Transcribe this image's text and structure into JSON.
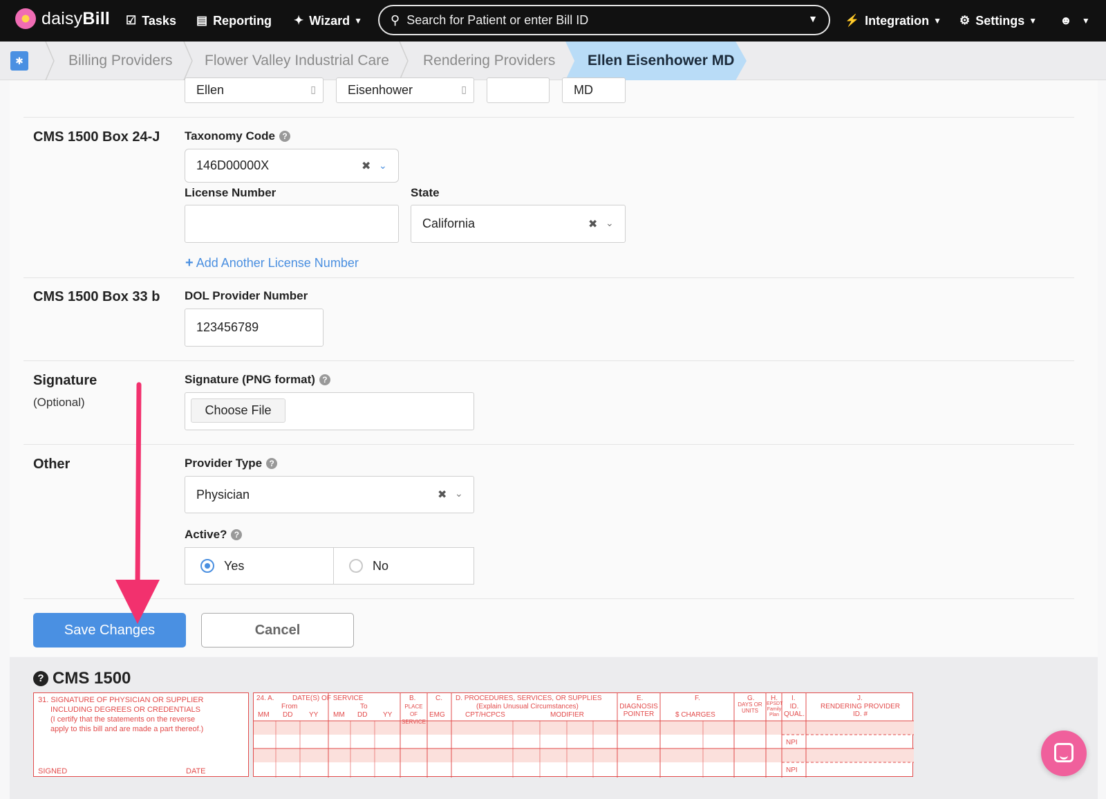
{
  "nav": {
    "logo_prefix": "daisy",
    "logo_suffix": "Bill",
    "tasks": "Tasks",
    "reporting": "Reporting",
    "wizard": "Wizard",
    "search_placeholder": "Search for Patient or enter Bill ID",
    "integration": "Integration",
    "settings": "Settings"
  },
  "breadcrumbs": [
    "Billing Providers",
    "Flower Valley Industrial Care",
    "Rendering Providers",
    "Ellen Eisenhower MD"
  ],
  "name_row": {
    "first_name": "Ellen",
    "last_name": "Eisenhower",
    "middle": "",
    "suffix": "MD"
  },
  "box24j": {
    "label": "CMS 1500 Box 24-J",
    "taxonomy_label": "Taxonomy Code",
    "taxonomy_value": "146D00000X",
    "license_label": "License Number",
    "license_value": "",
    "state_label": "State",
    "state_value": "California",
    "add_license": "Add Another License Number"
  },
  "box33b": {
    "label": "CMS 1500 Box 33 b",
    "dol_label": "DOL Provider Number",
    "dol_value": "123456789"
  },
  "signature": {
    "label": "Signature",
    "sublabel": "(Optional)",
    "field_label": "Signature (PNG format)",
    "choose_file": "Choose File"
  },
  "other": {
    "label": "Other",
    "provider_type_label": "Provider Type",
    "provider_type_value": "Physician",
    "active_label": "Active?",
    "yes": "Yes",
    "no": "No",
    "active_selected": "Yes"
  },
  "actions": {
    "save": "Save Changes",
    "cancel": "Cancel"
  },
  "cms1500": {
    "title": "CMS 1500",
    "box31_line1": "31. SIGNATURE OF PHYSICIAN OR SUPPLIER",
    "box31_line2": "INCLUDING DEGREES OR CREDENTIALS",
    "box31_line3": "(I certify that the statements on the reverse",
    "box31_line4": "apply to this bill and are made a part thereof.)",
    "signed": "SIGNED",
    "date": "DATE",
    "col_24a": "24. A.",
    "col_dates": "DATE(S) OF SERVICE",
    "col_from": "From",
    "col_to": "To",
    "col_mm": "MM",
    "col_dd": "DD",
    "col_yy": "YY",
    "col_b": "B.",
    "col_place": "PLACE OF SERVICE",
    "col_c": "C.",
    "col_emg": "EMG",
    "col_d": "D. PROCEDURES, SERVICES, OR SUPPLIES",
    "col_d_sub": "(Explain Unusual Circumstances)",
    "col_cpt": "CPT/HCPCS",
    "col_modifier": "MODIFIER",
    "col_e": "E.",
    "col_diag": "DIAGNOSIS POINTER",
    "col_f": "F.",
    "col_charges": "$ CHARGES",
    "col_g": "G.",
    "col_days": "DAYS OR UNITS",
    "col_h": "H.",
    "col_epsdt": "EPSDT Family Plan",
    "col_i": "I.",
    "col_id": "ID. QUAL.",
    "col_j": "J.",
    "col_rendering": "RENDERING PROVIDER ID. #",
    "npi": "NPI"
  },
  "colors": {
    "nav_bg": "#111111",
    "accent": "#4a90e2",
    "breadcrumb_active": "#b9dcf7",
    "form_red": "#e24a4a",
    "arrow_pink": "#f2316e",
    "chat": "#f0609c"
  }
}
